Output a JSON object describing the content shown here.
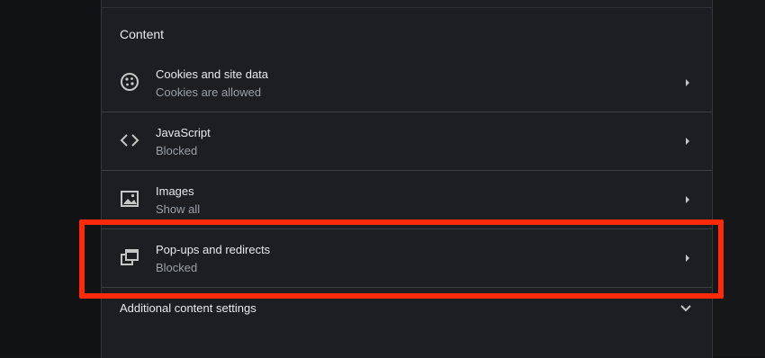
{
  "section": {
    "title": "Content"
  },
  "rows": [
    {
      "title": "Cookies and site data",
      "subtitle": "Cookies are allowed",
      "icon": "cookie-icon"
    },
    {
      "title": "JavaScript",
      "subtitle": "Blocked",
      "icon": "code-icon"
    },
    {
      "title": "Images",
      "subtitle": "Show all",
      "icon": "image-icon"
    },
    {
      "title": "Pop-ups and redirects",
      "subtitle": "Blocked",
      "icon": "popup-icon"
    }
  ],
  "additional": {
    "label": "Additional content settings",
    "icon": "chevron-down-icon"
  },
  "colors": {
    "panel": "#1c1e22",
    "text_primary": "#e8eaed",
    "text_secondary": "#9aa0a6",
    "highlight": "#ff2a0a"
  }
}
